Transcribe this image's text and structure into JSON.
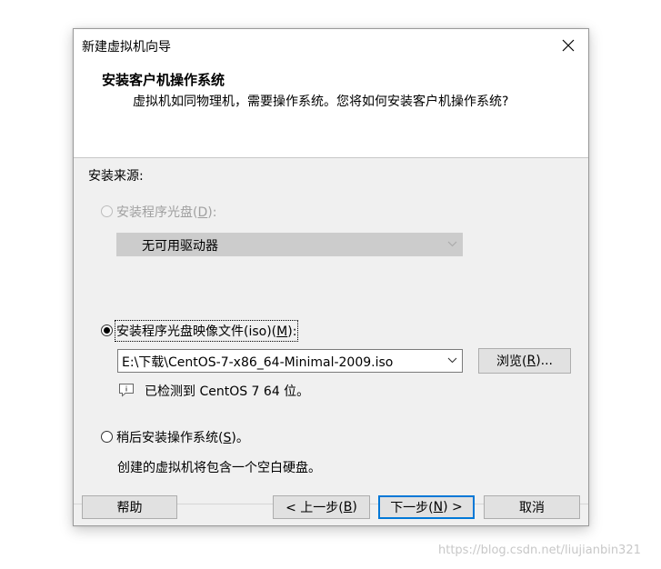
{
  "window": {
    "title": "新建虚拟机向导"
  },
  "header": {
    "title": "安装客户机操作系统",
    "subtitle": "虚拟机如同物理机，需要操作系统。您将如何安装客户机操作系统?"
  },
  "source": {
    "group_label": "安装来源:",
    "option_disc": {
      "label_prefix": "安装程序光盘(",
      "mnemonic": "D",
      "label_suffix": "):",
      "selected": false,
      "enabled": false
    },
    "disc_drive": {
      "value": "无可用驱动器"
    },
    "option_iso": {
      "label_prefix": "安装程序光盘映像文件(iso)(",
      "mnemonic": "M",
      "label_suffix": "):",
      "selected": true
    },
    "iso_path": {
      "value": "E:\\下载\\CentOS-7-x86_64-Minimal-2009.iso"
    },
    "browse_button": {
      "label_prefix": "浏览(",
      "mnemonic": "R",
      "label_suffix": ")..."
    },
    "detected": {
      "text": "已检测到 CentOS 7 64 位。"
    },
    "option_later": {
      "label_prefix": "稍后安装操作系统(",
      "mnemonic": "S",
      "label_suffix": ")。",
      "selected": false
    },
    "later_description": "创建的虚拟机将包含一个空白硬盘。"
  },
  "footer": {
    "help": "帮助",
    "back": {
      "label_prefix": "< 上一步(",
      "mnemonic": "B",
      "label_suffix": ")"
    },
    "next": {
      "label_prefix": "下一步(",
      "mnemonic": "N",
      "label_suffix": ") >"
    },
    "cancel": "取消"
  },
  "watermark": "https://blog.csdn.net/liujianbin321",
  "colors": {
    "dialog_bg": "#f0f0f0",
    "header_bg": "#ffffff",
    "default_button_border": "#0078d7",
    "disabled_text": "#a0a0a0"
  },
  "icons": {
    "close": "close-icon",
    "dropdown": "chevron-down-icon",
    "info": "info-message-icon"
  }
}
